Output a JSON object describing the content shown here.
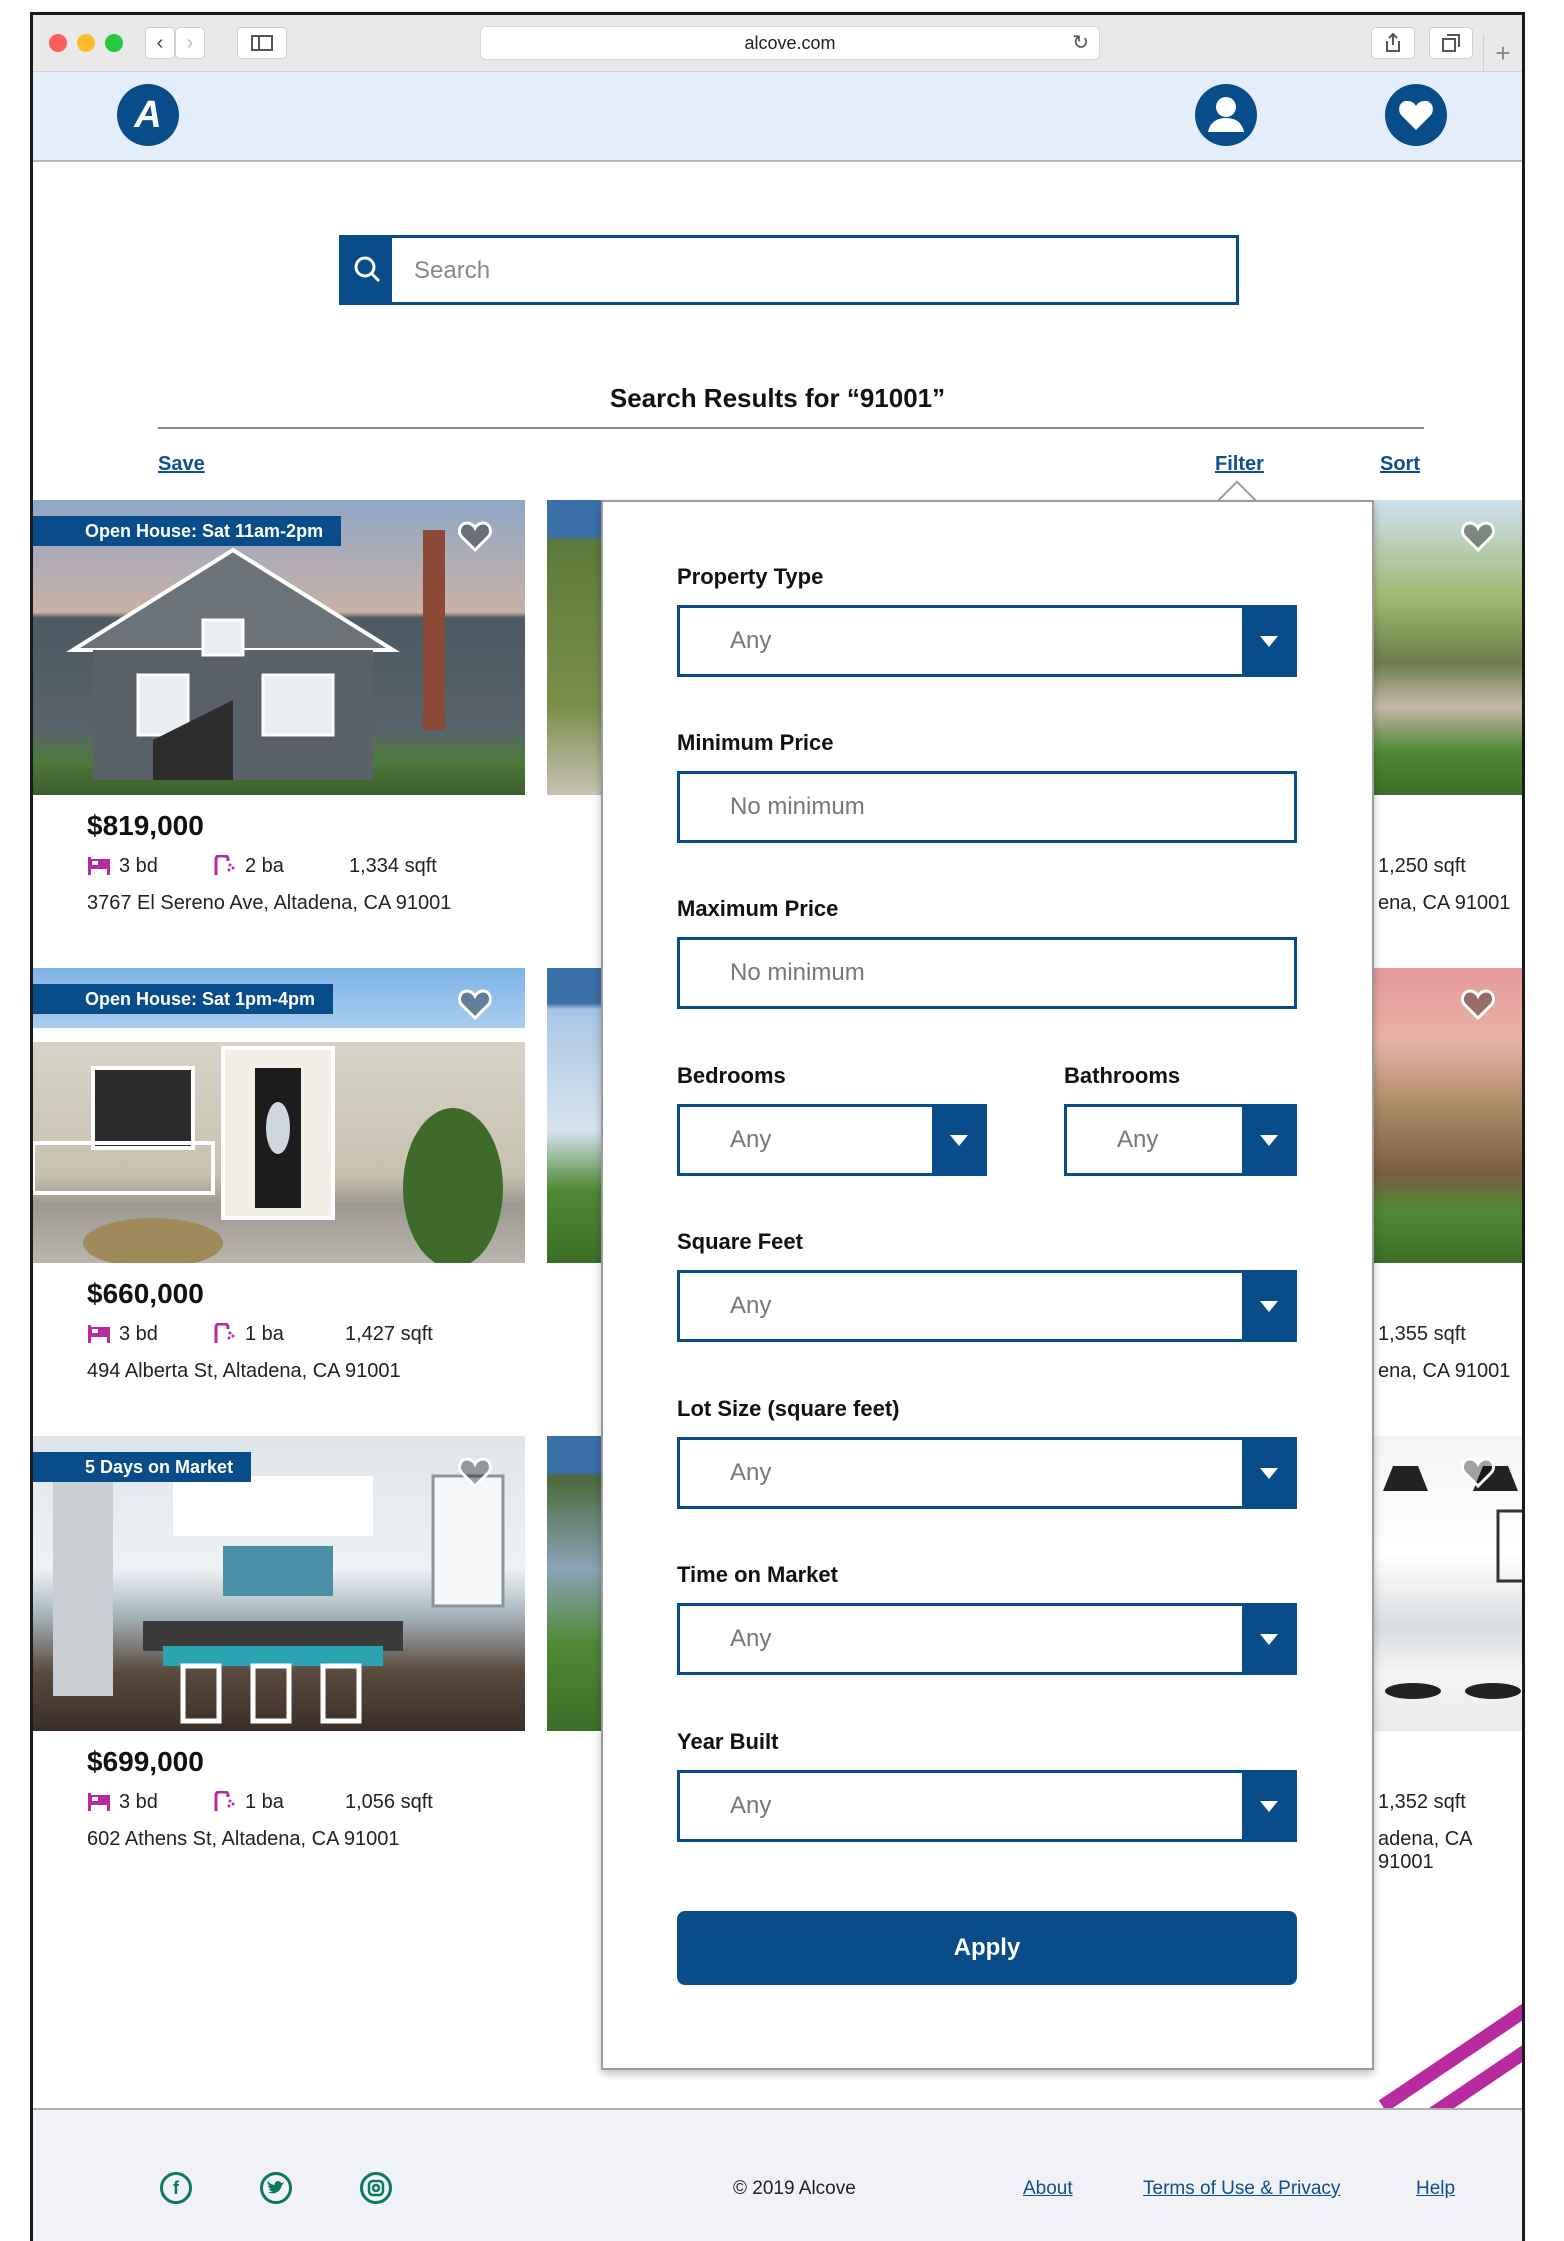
{
  "browser": {
    "url": "alcove.com"
  },
  "search": {
    "placeholder": "Search",
    "results_title": "Search Results for “91001”"
  },
  "toolbar": {
    "save_label": "Save",
    "filter_label": "Filter",
    "sort_label": "Sort"
  },
  "listings": [
    {
      "badge": "Open House: Sat 11am-2pm",
      "price": "$819,000",
      "beds": "3 bd",
      "baths": "2 ba",
      "sqft": "1,334 sqft",
      "address": "3767 El Sereno Ave, Altadena, CA 91001"
    },
    {
      "badge": "Open House: Sat 1pm-4pm",
      "price": "$660,000",
      "beds": "3 bd",
      "baths": "1 ba",
      "sqft": "1,427 sqft",
      "address": "494 Alberta St, Altadena, CA 91001"
    },
    {
      "badge": "5 Days on Market",
      "price": "$699,000",
      "beds": "3 bd",
      "baths": "1 ba",
      "sqft": "1,056 sqft",
      "address": "602 Athens St, Altadena, CA 91001"
    }
  ],
  "right_listings": [
    {
      "sqft": "1,250 sqft",
      "address_fragment": "ena, CA 91001"
    },
    {
      "sqft": "1,355 sqft",
      "address_fragment": "ena, CA 91001"
    },
    {
      "sqft": "1,352 sqft",
      "address_fragment": "adena, CA 91001"
    }
  ],
  "filter": {
    "property_type": {
      "label": "Property Type",
      "value": "Any"
    },
    "min_price": {
      "label": "Minimum Price",
      "placeholder": "No minimum"
    },
    "max_price": {
      "label": "Maximum Price",
      "placeholder": "No minimum"
    },
    "bedrooms": {
      "label": "Bedrooms",
      "value": "Any"
    },
    "bathrooms": {
      "label": "Bathrooms",
      "value": "Any"
    },
    "square_feet": {
      "label": "Square Feet",
      "value": "Any"
    },
    "lot_size": {
      "label": "Lot Size (square feet)",
      "value": "Any"
    },
    "time_on_market": {
      "label": "Time on Market",
      "value": "Any"
    },
    "year_built": {
      "label": "Year Built",
      "value": "Any"
    },
    "apply_label": "Apply"
  },
  "footer": {
    "copyright": "© 2019 Alcove",
    "about": "About",
    "terms": "Terms of Use & Privacy",
    "help": "Help"
  },
  "colors": {
    "brand_blue": "#084c8a",
    "header_bg": "#e3eefa",
    "accent_magenta": "#b82aa0",
    "social_green": "#0a7a5a"
  }
}
